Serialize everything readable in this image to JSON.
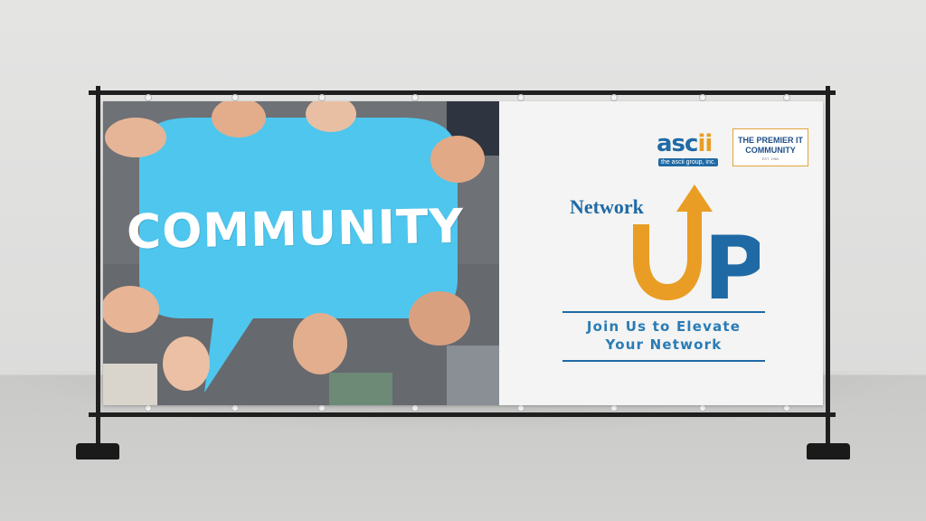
{
  "photo": {
    "bubble_text": "COMMUNITY",
    "bubble_color": "#4ec6ee"
  },
  "logo": {
    "name_main": "asc",
    "name_accent": "ii",
    "tagline": "the ascii group, inc.",
    "badge_line1": "THE PREMIER IT",
    "badge_line2": "COMMUNITY",
    "badge_est": "EST. 1984"
  },
  "headline": {
    "network": "Network",
    "up_u": "U",
    "up_p": "P"
  },
  "tagline": {
    "line1": "Join Us to Elevate",
    "line2": "Your Network"
  },
  "colors": {
    "brand_blue": "#1f6aa5",
    "brand_orange": "#e99d24",
    "frame": "#1f1f1f"
  }
}
